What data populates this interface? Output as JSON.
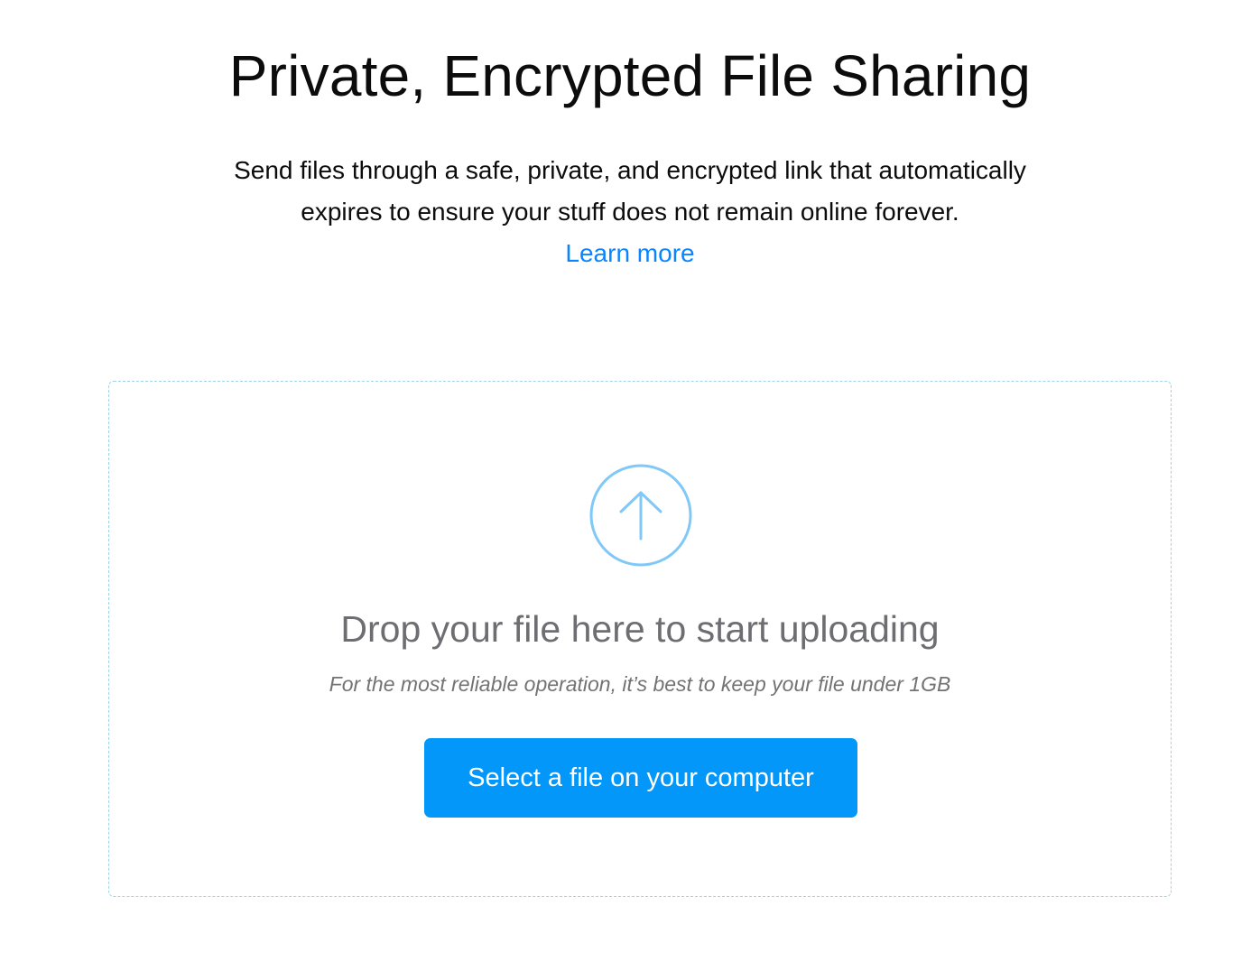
{
  "header": {
    "title": "Private, Encrypted File Sharing"
  },
  "intro": {
    "line1": "Send files through a safe, private, and encrypted link that automatically",
    "line2": "expires to ensure your stuff does not remain online forever.",
    "learn_more": "Learn more"
  },
  "upload": {
    "icon": "upload-arrow-circle-icon",
    "title": "Drop your file here to start uploading",
    "hint": "For the most reliable operation, it’s best to keep your file under 1GB",
    "button_label": "Select a file on your computer"
  },
  "colors": {
    "accent": "#0297f8",
    "link": "#0a84ff",
    "icon": "#7fc8f8",
    "dropzone_border": "#9fd3ea",
    "muted_text": "#6e6e72"
  }
}
